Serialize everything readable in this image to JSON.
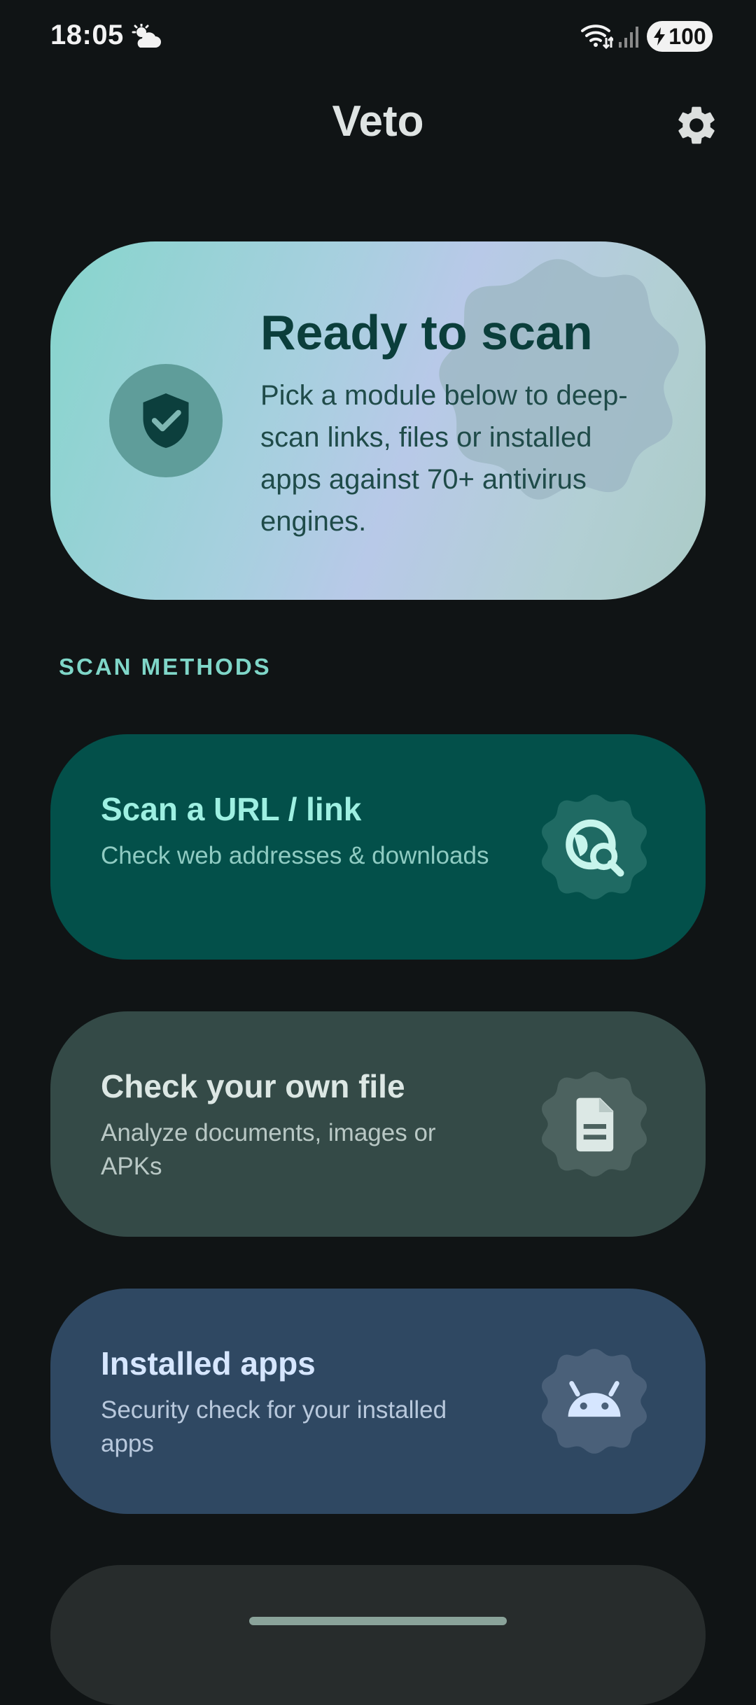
{
  "status_bar": {
    "time": "18:05",
    "battery": "100"
  },
  "app_bar": {
    "title": "Veto"
  },
  "hero": {
    "title": "Ready to scan",
    "description": "Pick a module below to deep-scan links, files or installed apps against 70+ antivirus engines."
  },
  "section_label": "SCAN METHODS",
  "methods": [
    {
      "title": "Scan a URL / link",
      "subtitle": "Check web addresses & downloads",
      "icon": "travel-explore-icon"
    },
    {
      "title": "Check your own file",
      "subtitle": "Analyze documents, images or APKs",
      "icon": "file-icon"
    },
    {
      "title": "Installed apps",
      "subtitle": "Security check for your installed apps",
      "icon": "android-icon"
    }
  ],
  "colors": {
    "background": "#101415",
    "accent": "#7fd6c8",
    "url_card": "#03504a",
    "file_card": "#344a47",
    "apps_card": "#2f4862"
  }
}
